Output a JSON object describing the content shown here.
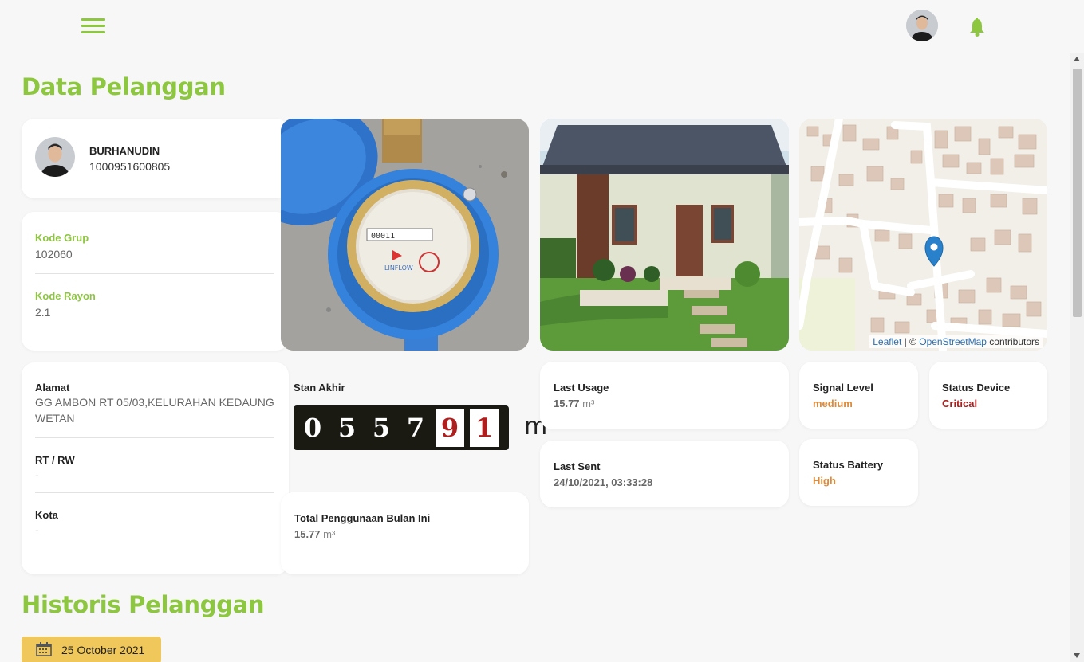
{
  "header": {
    "menu_icon": "hamburger-icon",
    "avatar_icon": "user-avatar",
    "notification_icon": "bell-icon"
  },
  "section1": {
    "title": "Data Pelanggan"
  },
  "customer": {
    "name": "BURHANUDIN",
    "id": "1000951600805"
  },
  "group": {
    "kode_grup_label": "Kode Grup",
    "kode_grup_value": "102060",
    "kode_rayon_label": "Kode Rayon",
    "kode_rayon_value": "2.1"
  },
  "address": {
    "alamat_label": "Alamat",
    "alamat_value": "GG AMBON RT 05/03,KELURAHAN KEDAUNG WETAN",
    "rtrw_label": "RT / RW",
    "rtrw_value": "-",
    "kota_label": "Kota",
    "kota_value": "-"
  },
  "stan_akhir": {
    "label": "Stan Akhir",
    "digits": [
      "0",
      "5",
      "5",
      "7",
      "9",
      "1"
    ],
    "unit": "m"
  },
  "total_usage": {
    "label": "Total Penggunaan Bulan Ini",
    "value": "15.77",
    "unit": "m³"
  },
  "last_usage": {
    "label": "Last Usage",
    "value": "15.77",
    "unit": "m³"
  },
  "last_sent": {
    "label": "Last Sent",
    "value": "24/10/2021, 03:33:28"
  },
  "signal": {
    "label": "Signal Level",
    "value": "medium"
  },
  "device": {
    "label": "Status Device",
    "value": "Critical"
  },
  "battery": {
    "label": "Status Battery",
    "value": "High"
  },
  "map": {
    "attr_leaflet": "Leaflet",
    "attr_sep": " | © ",
    "attr_osm": "OpenStreetMap",
    "attr_contrib": " contributors",
    "marker_icon": "map-marker-icon"
  },
  "section2": {
    "title": "Historis Pelanggan",
    "date": "25 October 2021",
    "date_icon": "calendar-icon"
  },
  "colors": {
    "accent": "#8dc63f",
    "medium": "#dd8b3a",
    "critical": "#a81d1d",
    "date_button": "#f0c75a"
  }
}
